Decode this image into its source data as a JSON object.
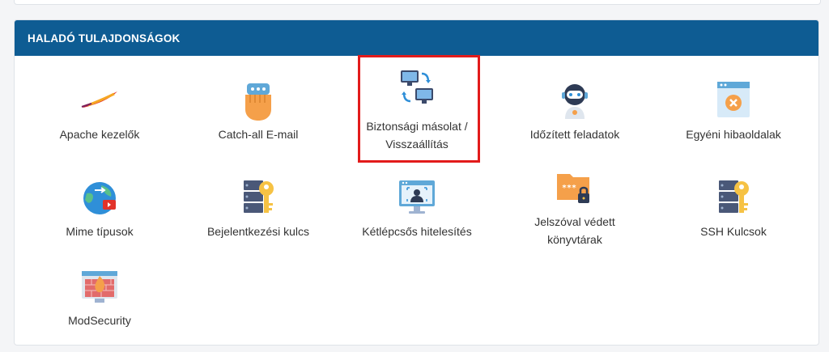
{
  "section": {
    "title": "HALADÓ TULAJDONSÁGOK"
  },
  "items": [
    {
      "label": "Apache kezelők",
      "icon": "apache-feather-icon"
    },
    {
      "label": "Catch-all E-mail",
      "icon": "catch-all-hand-icon"
    },
    {
      "label": "Biztonsági másolat / Visszaállítás",
      "icon": "backup-restore-icon"
    },
    {
      "label": "Időzített feladatok",
      "icon": "cron-robot-icon"
    },
    {
      "label": "Egyéni hibaoldalak",
      "icon": "error-page-icon"
    },
    {
      "label": "Mime típusok",
      "icon": "mime-globe-icon"
    },
    {
      "label": "Bejelentkezési kulcs",
      "icon": "login-key-icon"
    },
    {
      "label": "Kétlépcsős hitelesítés",
      "icon": "two-factor-monitor-icon"
    },
    {
      "label": "Jelszóval védett könyvtárak",
      "icon": "protected-folder-icon"
    },
    {
      "label": "SSH Kulcsok",
      "icon": "ssh-key-icon"
    },
    {
      "label": "ModSecurity",
      "icon": "modsecurity-firewall-icon"
    }
  ],
  "colors": {
    "header": "#0e5c93",
    "highlight": "#e21b1b"
  }
}
